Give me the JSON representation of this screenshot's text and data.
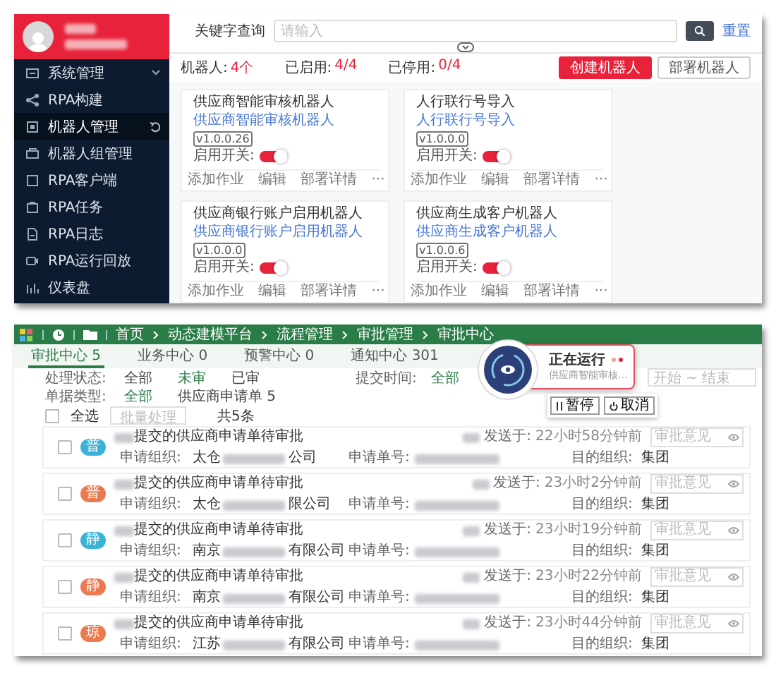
{
  "sidebar": {
    "items": [
      {
        "label": "系统管理",
        "selected": false,
        "has_submenu": true
      },
      {
        "label": "RPA构建",
        "selected": false,
        "has_submenu": false
      },
      {
        "label": "机器人管理",
        "selected": true,
        "has_submenu": false
      },
      {
        "label": "机器人组管理",
        "selected": false,
        "has_submenu": false
      },
      {
        "label": "RPA客户端",
        "selected": false,
        "has_submenu": false
      },
      {
        "label": "RPA任务",
        "selected": false,
        "has_submenu": false
      },
      {
        "label": "RPA日志",
        "selected": false,
        "has_submenu": false
      },
      {
        "label": "RPA运行回放",
        "selected": false,
        "has_submenu": false
      },
      {
        "label": "仪表盘",
        "selected": false,
        "has_submenu": false
      }
    ]
  },
  "search": {
    "label": "关键字查询",
    "placeholder": "请输入",
    "reset": "重置"
  },
  "stats": [
    {
      "label": "机器人:",
      "value": "4个"
    },
    {
      "label": "已启用:",
      "value": "4/4"
    },
    {
      "label": "已停用:",
      "value": "0/4"
    }
  ],
  "buttons": [
    {
      "label": "创建机器人",
      "kind": "primary"
    },
    {
      "label": "部署机器人",
      "kind": "default"
    }
  ],
  "cards": [
    {
      "title": "供应商智能审核机器人",
      "subtitle": "供应商智能审核机器人",
      "version": "v1.0.0.26",
      "switch_label": "启用开关:",
      "on": true,
      "actions": [
        "添加作业",
        "编辑",
        "部署详情",
        "···"
      ]
    },
    {
      "title": "人行联行号导入",
      "subtitle": "人行联行号导入",
      "version": "v1.0.0.0",
      "switch_label": "启用开关:",
      "on": true,
      "actions": [
        "添加作业",
        "编辑",
        "部署详情",
        "···"
      ]
    },
    {
      "title": "供应商银行账户启用机器人",
      "subtitle": "供应商银行账户启用机器人",
      "version": "v1.0.0.0",
      "switch_label": "启用开关:",
      "on": true,
      "actions": [
        "添加作业",
        "编辑",
        "部署详情",
        "···"
      ]
    },
    {
      "title": "供应商生成客户机器人",
      "subtitle": "供应商生成客户机器人",
      "version": "v1.0.0.6",
      "switch_label": "启用开关:",
      "on": true,
      "actions": [
        "添加作业",
        "编辑",
        "部署详情",
        "···"
      ]
    }
  ],
  "approval": {
    "breadcrumb": [
      "首页",
      "动态建模平台",
      "流程管理",
      "审批管理",
      "审批中心"
    ],
    "tabs": [
      {
        "label": "审批中心 5",
        "selected": true
      },
      {
        "label": "业务中心 0",
        "selected": false
      },
      {
        "label": "预警中心 0",
        "selected": false
      },
      {
        "label": "通知中心 301",
        "selected": false
      }
    ],
    "filters": [
      {
        "label": "处理状态:",
        "options": [
          {
            "label": "全部",
            "selected": false
          },
          {
            "label": "未审",
            "selected": true
          },
          {
            "label": "已审",
            "selected": false
          }
        ]
      },
      {
        "label": "单据类型:",
        "options": [
          {
            "label": "全部",
            "selected": true
          },
          {
            "label": "供应商申请单 5",
            "selected": false
          }
        ]
      }
    ],
    "time_filter": {
      "label": "提交时间:",
      "options": [
        {
          "label": "全部",
          "selected": true
        }
      ],
      "placeholder": "开始 ~ 结束"
    },
    "toolbar": {
      "select_all": "全选",
      "checked": false,
      "batch": "批量处理",
      "batch_disabled": true,
      "total": "共5条"
    },
    "rows": [
      {
        "avatar": "普",
        "color": "#3bb3d6",
        "title": "提交的供应商申请单待审批",
        "org_label": "申请组织:",
        "org_start": "太仓",
        "org_end": "公司",
        "number_label": "申请单号:",
        "target_label": "目的组织:",
        "target": "集团",
        "sent_label": "发送于:",
        "time": "22小时58分钟前",
        "placeholder": "审批意见",
        "checked": false
      },
      {
        "avatar": "普",
        "color": "#ec7a50",
        "title": "提交的供应商申请单待审批",
        "org_label": "申请组织:",
        "org_start": "太仓",
        "org_end": "限公司",
        "number_label": "申请单号:",
        "target_label": "目的组织:",
        "target": "集团",
        "sent_label": "发送于:",
        "time": "23小时2分钟前",
        "placeholder": "审批意见",
        "checked": false
      },
      {
        "avatar": "静",
        "color": "#3bb3d6",
        "title": "提交的供应商申请单待审批",
        "org_label": "申请组织:",
        "org_start": "南京",
        "org_end": "有限公司",
        "number_label": "申请单号:",
        "target_label": "目的组织:",
        "target": "集团",
        "sent_label": "发送于:",
        "time": "23小时19分钟前",
        "placeholder": "审批意见",
        "checked": false
      },
      {
        "avatar": "静",
        "color": "#ec7a50",
        "title": "提交的供应商申请单待审批",
        "org_label": "申请组织:",
        "org_start": "南京",
        "org_end": "有限公司",
        "number_label": "申请单号:",
        "target_label": "目的组织:",
        "target": "集团",
        "sent_label": "发送于:",
        "time": "23小时22分钟前",
        "placeholder": "审批意见",
        "checked": false
      },
      {
        "avatar": "琼",
        "color": "#ec7a50",
        "title": "提交的供应商申请单待审批",
        "org_label": "申请组织:",
        "org_start": "江苏",
        "org_end": "有限公司",
        "number_label": "申请单号:",
        "target_label": "目的组织:",
        "target": "集团",
        "sent_label": "发送于:",
        "time": "23小时44分钟前",
        "placeholder": "审批意见",
        "checked": false
      }
    ],
    "popup": {
      "status": "正在运行",
      "task": "供应商智能审核...",
      "buttons": [
        {
          "label": "暂停",
          "kind": "pause"
        },
        {
          "label": "取消",
          "kind": "cancel"
        }
      ]
    }
  }
}
